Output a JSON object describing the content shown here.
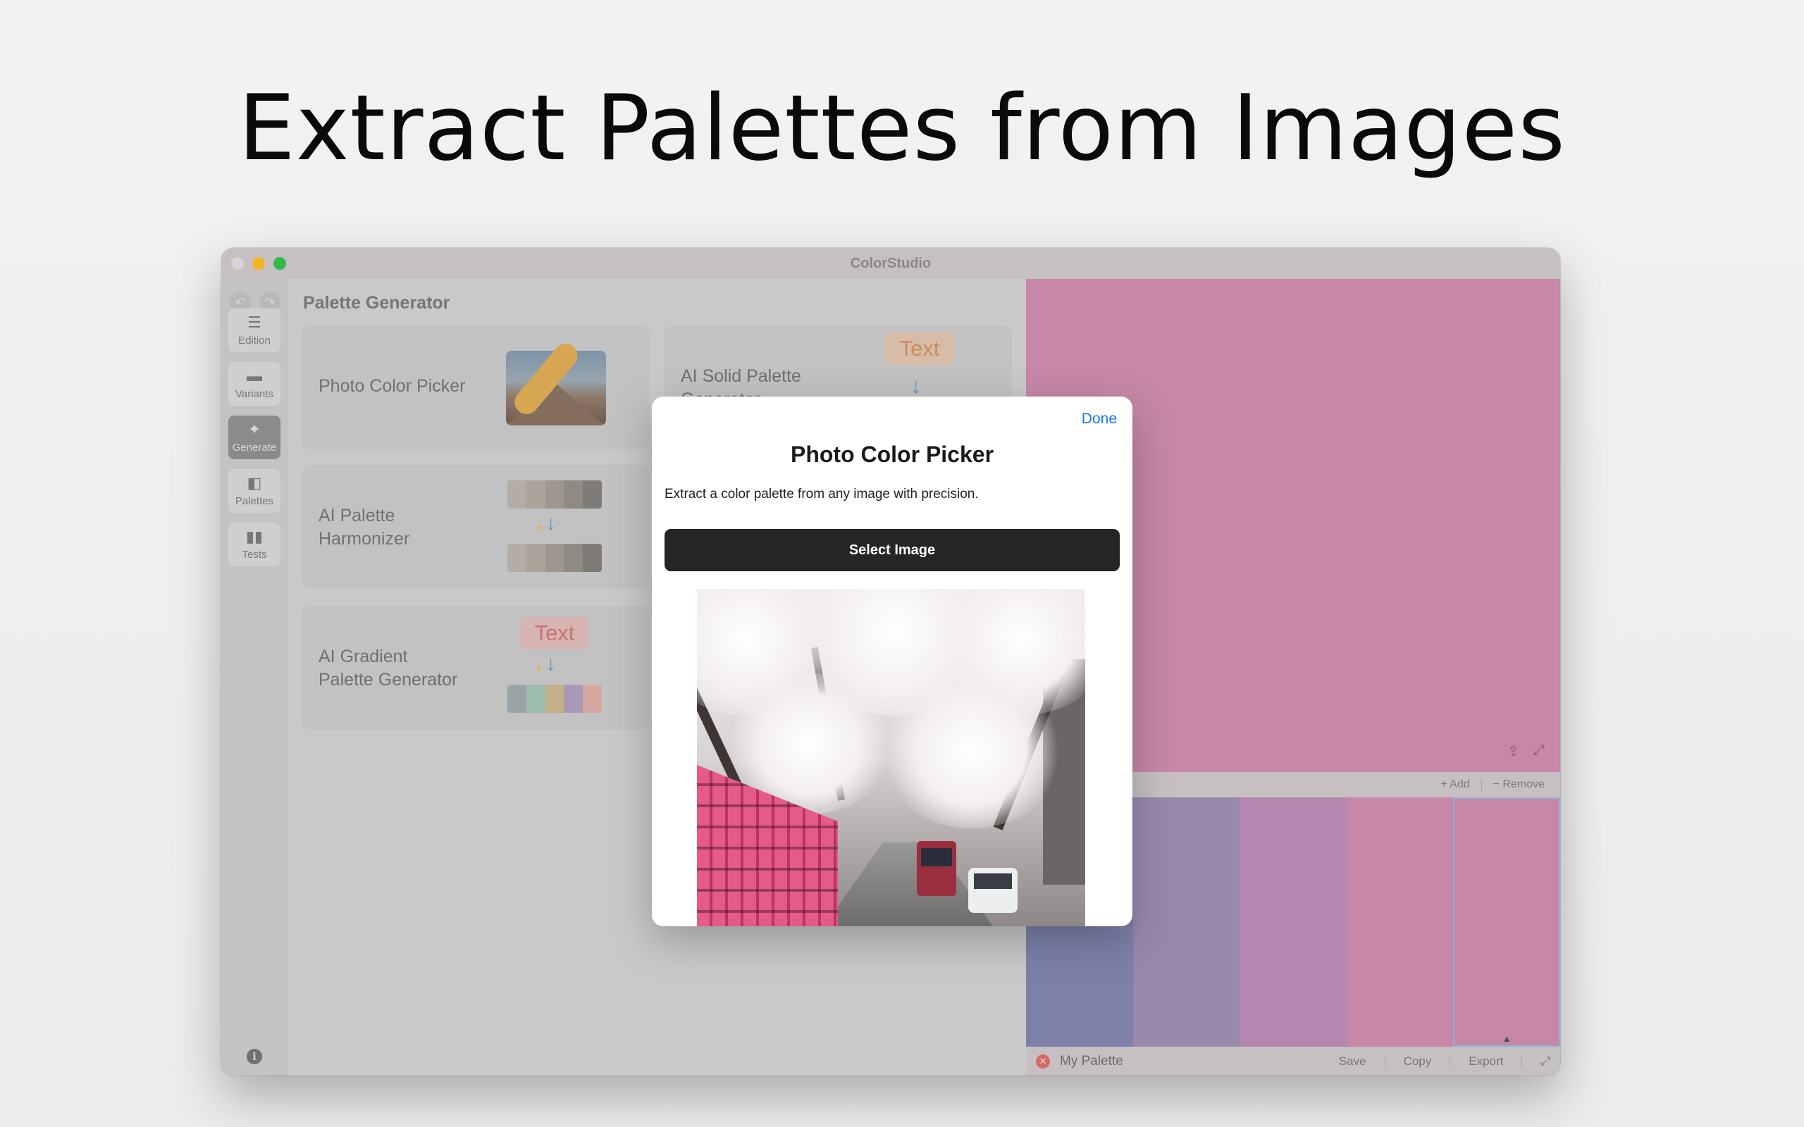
{
  "headline": "Extract Palettes from Images",
  "window": {
    "title": "ColorStudio"
  },
  "sidebar": {
    "items": [
      {
        "label": "Edition",
        "icon": "sliders-icon"
      },
      {
        "label": "Variants",
        "icon": "stack-icon"
      },
      {
        "label": "Generate",
        "icon": "sparkle-icon",
        "active": true
      },
      {
        "label": "Palettes",
        "icon": "palette-icon"
      },
      {
        "label": "Tests",
        "icon": "test-tubes-icon"
      }
    ]
  },
  "content": {
    "section_title": "Palette Generator",
    "cards": [
      {
        "title": "Photo Color Picker"
      },
      {
        "title": "AI Solid Palette Generator",
        "badge": "Text"
      },
      {
        "title_line1": "AI Palette",
        "title_line2": "Harmonizer"
      },
      {
        "title_line1": "AI Gradient",
        "title_line2": "Palette Generator",
        "badge": "Text"
      }
    ]
  },
  "right_panel": {
    "preview_color": "#c688a6",
    "toolbar": {
      "add": "+ Add",
      "remove": "− Remove"
    },
    "strips": [
      "#7e80aa",
      "#9889ac",
      "#b487af",
      "#c688a6"
    ],
    "palette_name": "My Palette",
    "actions": {
      "save": "Save",
      "copy": "Copy",
      "export": "Export"
    }
  },
  "modal": {
    "done": "Done",
    "title": "Photo Color Picker",
    "description": "Extract a color palette from any image with precision.",
    "select_button": "Select Image"
  },
  "colors": {
    "accent": "#1677e8",
    "harmonizer_swatches": [
      "#b3ada5",
      "#a9a39a",
      "#9d978f",
      "#8f8a83",
      "#807b76"
    ],
    "gradient_swatches": [
      "#9aa3a7",
      "#9cbcae",
      "#c3b087",
      "#a999b7",
      "#d7a7a1"
    ]
  }
}
